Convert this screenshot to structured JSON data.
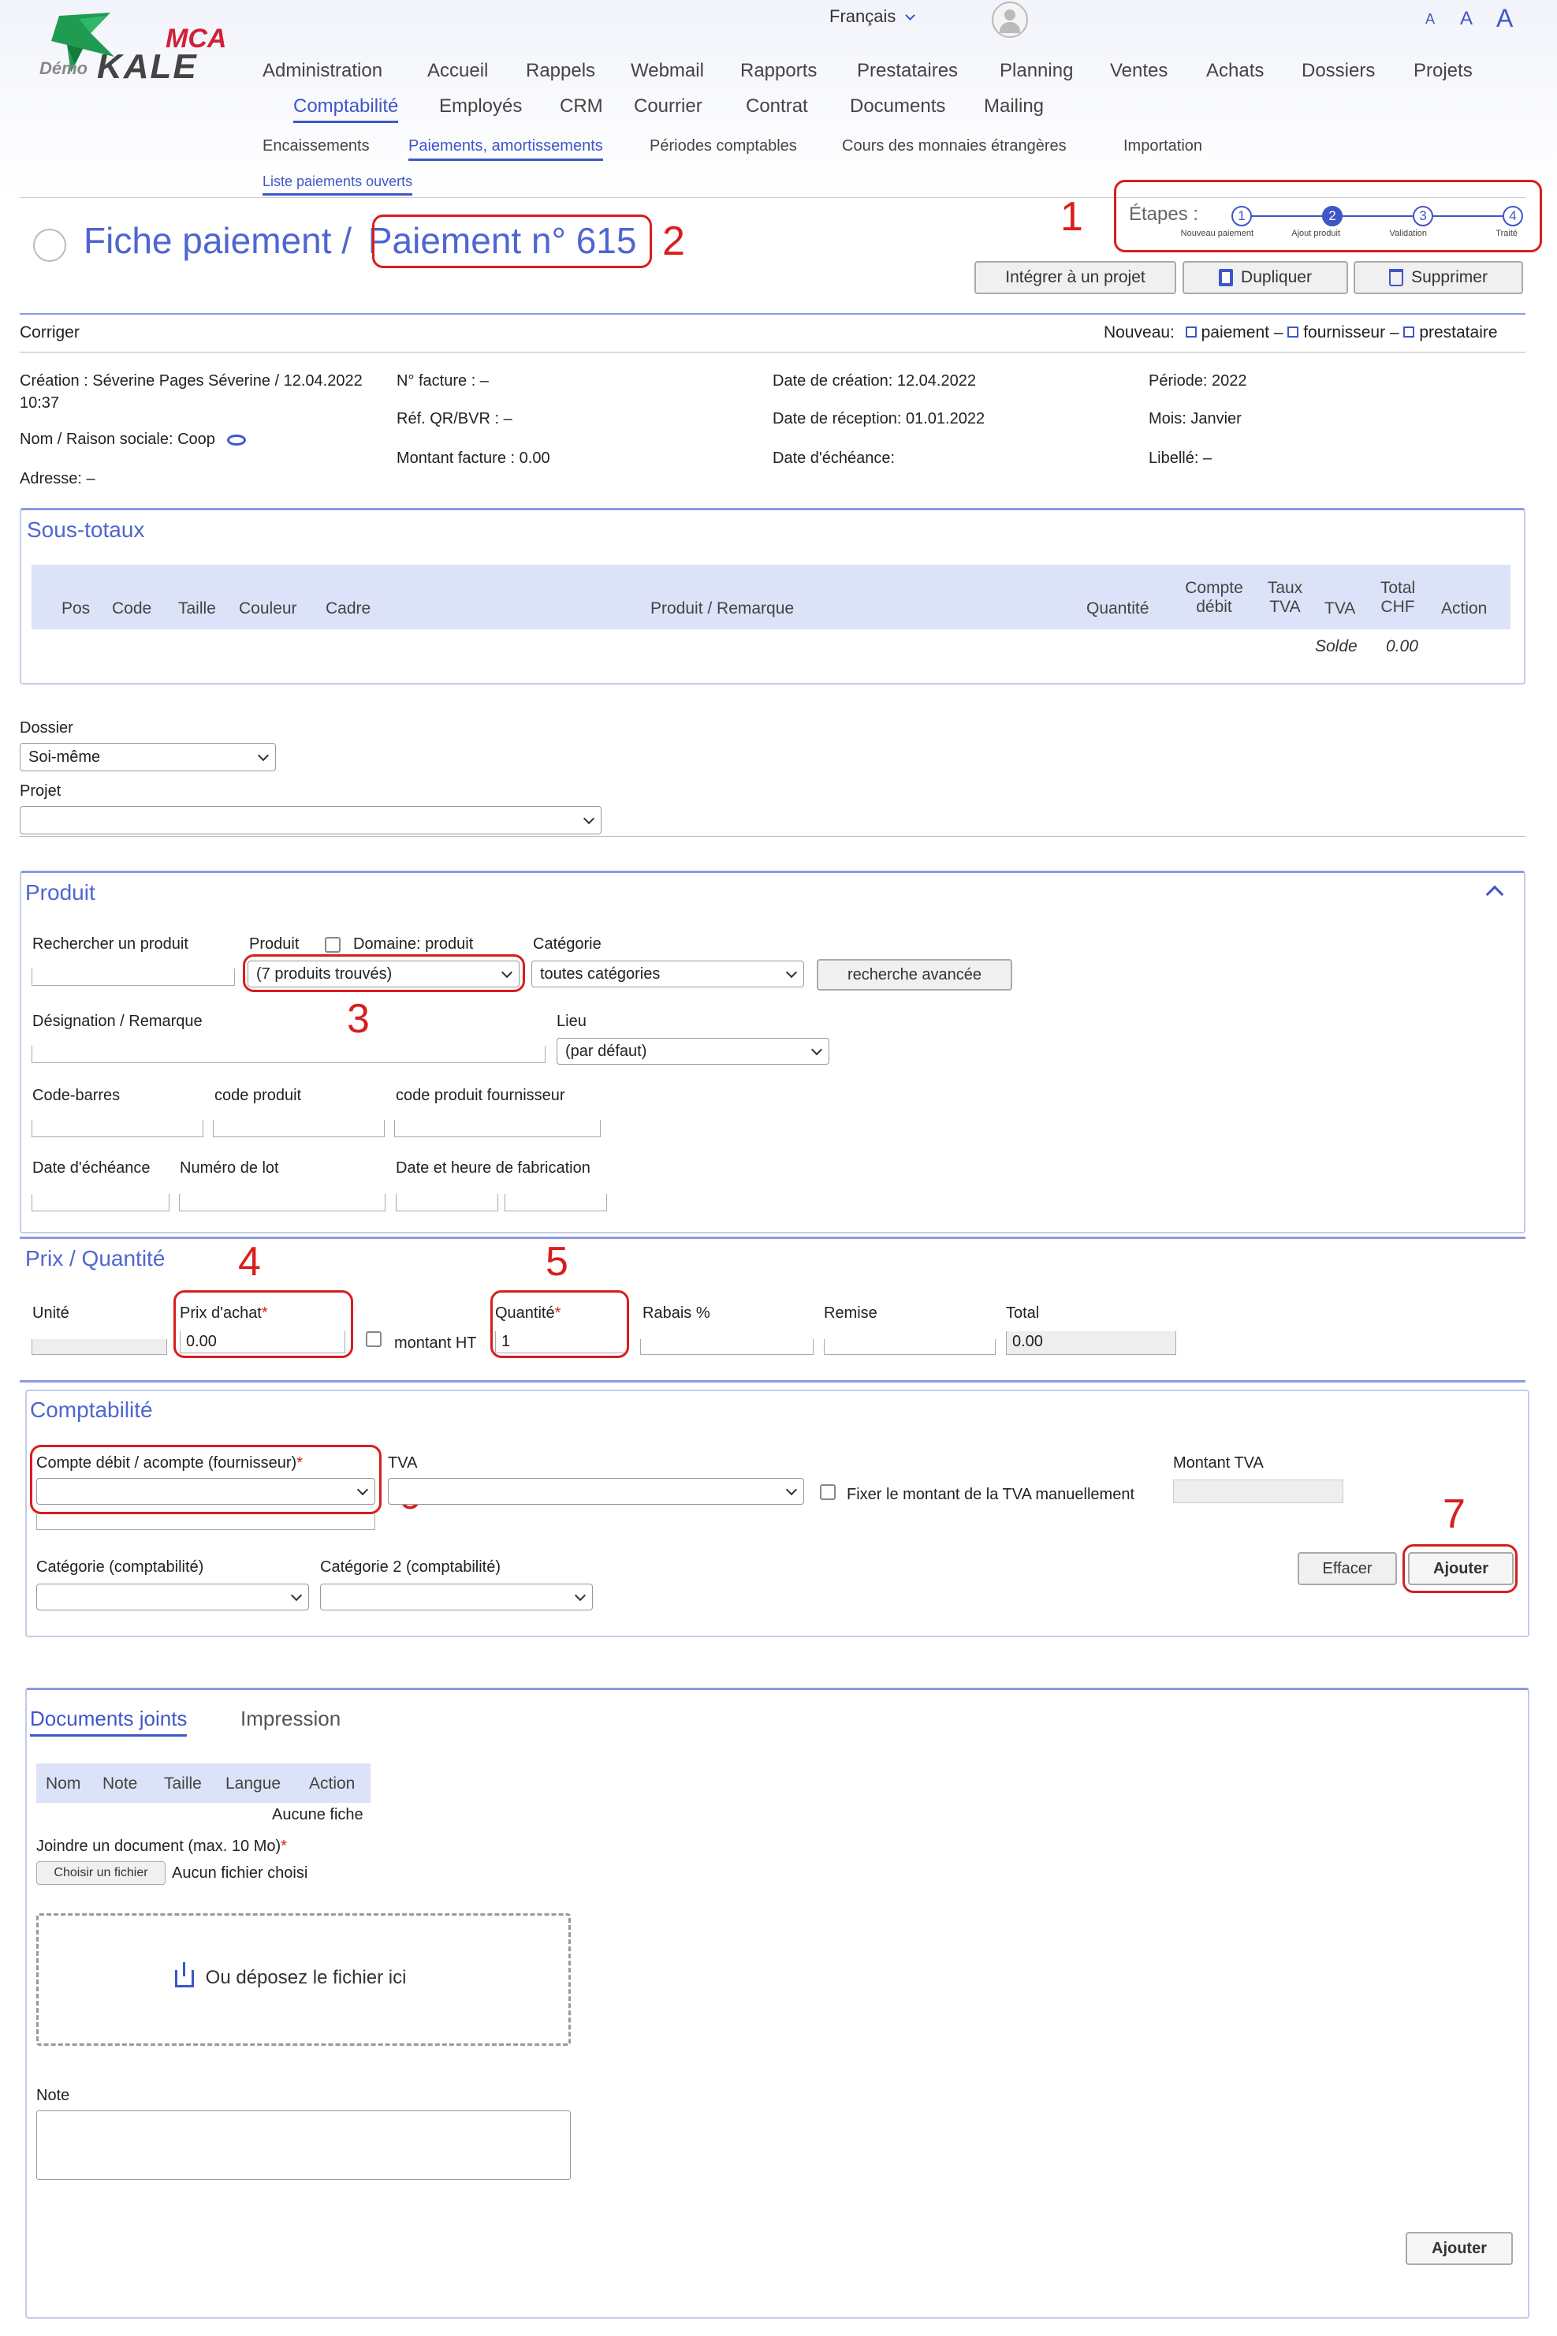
{
  "header": {
    "logo_mca": "MCA",
    "logo_demo": "Démo",
    "logo_kale": "KALE",
    "language": "Français",
    "font_sizes": [
      "A",
      "A",
      "A"
    ],
    "nav_row1": [
      "Administration",
      "Accueil",
      "Rappels",
      "Webmail",
      "Rapports",
      "Prestataires",
      "Planning",
      "Ventes",
      "Achats",
      "Dossiers",
      "Projets"
    ],
    "nav_row2": [
      "Comptabilité",
      "Employés",
      "CRM",
      "Courrier",
      "Contrat",
      "Documents",
      "Mailing"
    ],
    "sub_nav": [
      "Encaissements",
      "Paiements, amortissements",
      "Périodes comptables",
      "Cours des monnaies étrangères",
      "Importation"
    ],
    "sub_sub_nav": "Liste paiements ouverts"
  },
  "page": {
    "title_prefix": "Fiche paiement /",
    "title_record": "Paiement n° 615",
    "steps_label": "Étapes :",
    "steps": [
      {
        "n": "1",
        "label": "Nouveau paiement"
      },
      {
        "n": "2",
        "label": "Ajout produit"
      },
      {
        "n": "3",
        "label": "Validation"
      },
      {
        "n": "4",
        "label": "Traité"
      }
    ],
    "current_step": 2,
    "actions": {
      "integrate": "Intégrer à un projet",
      "duplicate": "Dupliquer",
      "delete": "Supprimer"
    },
    "correct_link": "Corriger",
    "new_label": "Nouveau:",
    "new_links": [
      "paiement",
      "fournisseur",
      "prestataire"
    ],
    "new_sep": "–"
  },
  "annotations": [
    "1",
    "2",
    "3",
    "4",
    "5",
    "6",
    "7"
  ],
  "info": {
    "creation": "Création : Séverine   Pages Séverine / 12.04.2022",
    "creation_time": "10:37",
    "name": "Nom / Raison sociale: Coop",
    "address": "Adresse: –",
    "invoice_no": "N° facture : –",
    "ref_qr": "Réf. QR/BVR : –",
    "invoice_amount": "Montant facture : 0.00",
    "date_created": "Date de création: 12.04.2022",
    "date_received": "Date de réception: 01.01.2022",
    "date_due": "Date d'échéance:",
    "period": "Période: 2022",
    "month": "Mois: Janvier",
    "label": "Libellé: –"
  },
  "subtotals": {
    "title": "Sous-totaux",
    "columns": [
      "Pos",
      "Code",
      "Taille",
      "Couleur",
      "Cadre",
      "Produit / Remarque",
      "Quantité",
      "Compte débit",
      "Taux TVA",
      "TVA",
      "Total CHF",
      "Action"
    ],
    "balance_label": "Solde",
    "balance_value": "0.00"
  },
  "dossier": {
    "label": "Dossier",
    "value": "Soi-même",
    "project_label": "Projet",
    "project_value": ""
  },
  "product": {
    "title": "Produit",
    "search_label": "Rechercher un produit",
    "product_label": "Produit",
    "domain_label": "Domaine: produit",
    "product_value": "(7 produits trouvés)",
    "category_label": "Catégorie",
    "category_value": "toutes catégories",
    "advanced_search": "recherche avancée",
    "designation_label": "Désignation / Remarque",
    "location_label": "Lieu",
    "location_value": "(par défaut)",
    "barcode_label": "Code-barres",
    "code_label": "code produit",
    "supplier_code_label": "code produit fournisseur",
    "due_date_label": "Date d'échéance",
    "lot_label": "Numéro de lot",
    "manufacture_label": "Date et heure de fabrication"
  },
  "price": {
    "title": "Prix / Quantité",
    "unit_label": "Unité",
    "purchase_price_label": "Prix d'achat",
    "purchase_price_value": "0.00",
    "ht_label": "montant HT",
    "quantity_label": "Quantité",
    "quantity_value": "1",
    "discount_pct_label": "Rabais %",
    "discount_label": "Remise",
    "total_label": "Total",
    "total_value": "0.00",
    "required_mark": "*"
  },
  "accounting": {
    "title": "Comptabilité",
    "debit_label": "Compte débit / acompte (fournisseur)",
    "vat_label": "TVA",
    "vat_manual_label": "Fixer le montant de la TVA manuellement",
    "vat_amount_label": "Montant TVA",
    "category_label": "Catégorie (comptabilité)",
    "category2_label": "Catégorie 2 (comptabilité)",
    "clear_button": "Effacer",
    "add_button": "Ajouter"
  },
  "documents": {
    "tab_docs": "Documents joints",
    "tab_print": "Impression",
    "columns": [
      "Nom",
      "Note",
      "Taille",
      "Langue",
      "Action"
    ],
    "empty": "Aucune fiche",
    "attach_label": "Joindre un document (max. 10 Mo)",
    "choose_file": "Choisir un fichier",
    "no_file": "Aucun fichier choisi",
    "drop_text": "Ou déposez le fichier ici",
    "note_label": "Note",
    "add_button": "Ajouter"
  },
  "colors": {
    "accent": "#3f56c8",
    "annotation": "#d91e1e",
    "logo_green": "#1f9b52",
    "logo_red": "#d0213a"
  }
}
